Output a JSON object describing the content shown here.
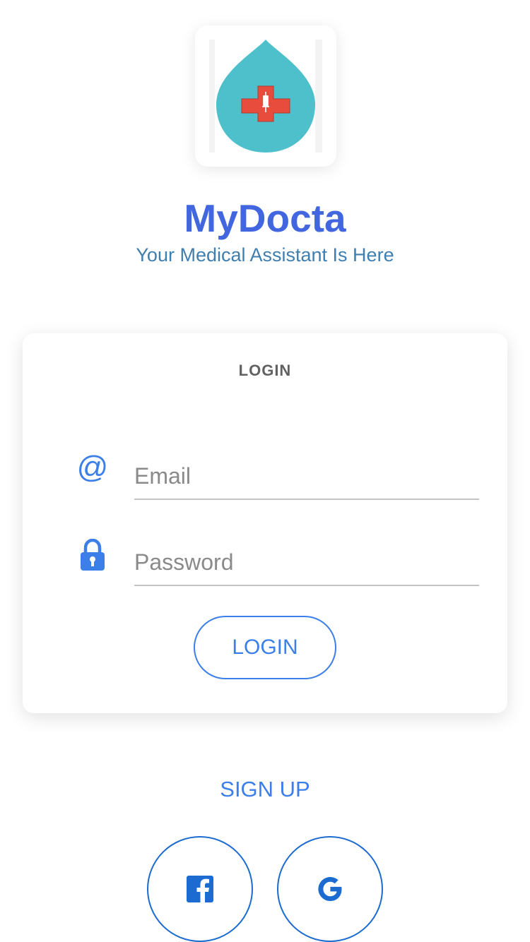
{
  "colors": {
    "title": "#4166E0",
    "subtitle": "#3F7FB0",
    "accent": "#3D7FE8",
    "social": "#1B6BD0",
    "drop": "#4EC0CC",
    "cross": "#E74C3C"
  },
  "app": {
    "name": "MyDocta",
    "tagline": "Your Medical Assistant Is Here",
    "logo_icon": "medical-drop-icon"
  },
  "login_card": {
    "title": "LOGIN",
    "email": {
      "icon": "at-icon",
      "value": "",
      "placeholder": "Email"
    },
    "password": {
      "icon": "lock-icon",
      "value": "",
      "placeholder": "Password"
    },
    "submit_label": "LOGIN"
  },
  "signup_label": "SIGN UP",
  "social": [
    {
      "icon": "facebook-icon"
    },
    {
      "icon": "google-icon"
    }
  ]
}
